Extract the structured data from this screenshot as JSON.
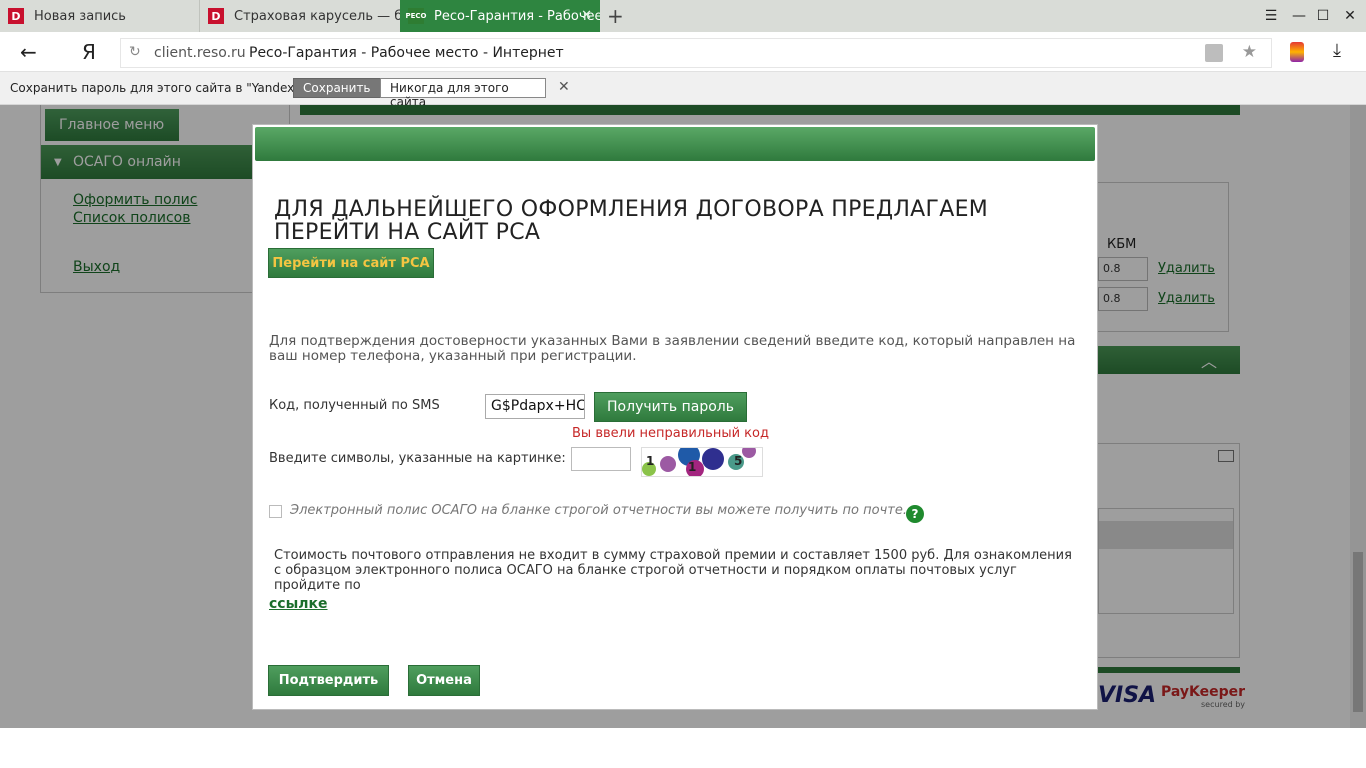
{
  "browser": {
    "tabs": [
      {
        "label": "Новая запись",
        "favicon": "D"
      },
      {
        "label": "Страховая карусель — бор",
        "favicon": "D"
      },
      {
        "label": "Ресо-Гарантия - Рабочее",
        "favicon": "РЕСО"
      }
    ],
    "url_host": "client.reso.ru",
    "url_title": "Ресо-Гарантия - Рабочее место - Интернет",
    "yandex_glyph": "Я"
  },
  "password_bar": {
    "message": "Сохранить пароль для этого сайта в \"Yandex\"?",
    "save_label": "Сохранить",
    "never_label": "Никогда для этого сайта"
  },
  "sidebar": {
    "main_menu": "Главное меню",
    "section": "ОСАГО онлайн",
    "links": [
      "Оформить полис",
      "Список полисов",
      "Выход"
    ]
  },
  "background_panel": {
    "kbm_header": "КБМ",
    "kbm_values": [
      "0.8",
      "0.8"
    ],
    "delete_label": "Удалить"
  },
  "footer_logos": {
    "visa": "VISA",
    "paykeeper": "PayKeeper",
    "paykeeper_sub": "secured by"
  },
  "modal": {
    "title": "ДЛЯ ДАЛЬНЕЙШЕГО ОФОРМЛЕНИЯ ДОГОВОРА ПРЕДЛАГАЕМ ПЕРЕЙТИ НА САЙТ РСА",
    "rsa_button": "Перейти на сайт РСА",
    "info": "Для подтверждения достоверности указанных Вами в заявлении сведений введите код, который направлен на ваш номер телефона, указанный при регистрации.",
    "sms_label": "Код, полученный по SMS",
    "sms_value": "G$Pdapx+HC",
    "get_password": "Получить пароль",
    "error": "Вы ввели неправильный код",
    "captcha_label": "Введите символы, указанные на картинке:",
    "captcha_chars": [
      "1",
      "1",
      "5"
    ],
    "checkbox_label": "Электронный полис ОСАГО на бланке строгой отчетности вы можете получить по почте.",
    "help_glyph": "?",
    "cost_text": "Стоимость почтового отправления не входит в сумму страховой премии и составляет 1500 руб. Для ознакомления с образцом электронного полиса ОСАГО на бланке строгой отчетности и порядком оплаты почтовых услуг пройдите по",
    "cost_link": "ссылке",
    "confirm": "Подтвердить",
    "cancel": "Отмена"
  },
  "colors": {
    "brand_green": "#2f7a3d",
    "active_tab": "#2e8540",
    "error_red": "#c62828"
  }
}
